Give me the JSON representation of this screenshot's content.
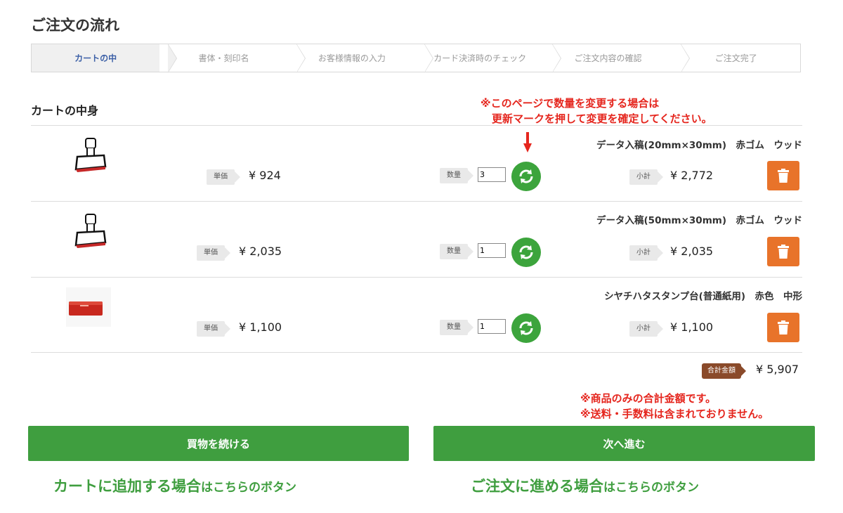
{
  "page_title": "ご注文の流れ",
  "steps": [
    {
      "label": "カートの中"
    },
    {
      "label": "書体・刻印名"
    },
    {
      "label": "お客様情報の入力"
    },
    {
      "label": "カード決済時のチェック"
    },
    {
      "label": "ご注文内容の確認"
    },
    {
      "label": "ご注文完了"
    }
  ],
  "active_step": 0,
  "cart_heading": "カートの中身",
  "notice_top": {
    "line1": "※このページで数量を変更する場合は",
    "line2": "更新マークを押して変更を確定してください。"
  },
  "labels": {
    "unit_price": "単価",
    "quantity": "数量",
    "subtotal": "小計",
    "total": "合計金額"
  },
  "items": [
    {
      "name": "データ入稿(20mm×30mm)　赤ゴム　ウッド",
      "unit_price": "¥ 924",
      "quantity": "3",
      "subtotal": "¥ 2,772",
      "image": "rubber-stamp-icon"
    },
    {
      "name": "データ入稿(50mm×30mm)　赤ゴム　ウッド",
      "unit_price": "¥ 2,035",
      "quantity": "1",
      "subtotal": "¥ 2,035",
      "image": "rubber-stamp-icon"
    },
    {
      "name": "シヤチハタスタンプ台(普通紙用)　赤色　中形",
      "unit_price": "¥ 1,100",
      "quantity": "1",
      "subtotal": "¥ 1,100",
      "image": "stamp-pad-icon"
    }
  ],
  "total_value": "¥ 5,907",
  "notice_bottom": {
    "line1": "※商品のみの合計金額です。",
    "line2": "※送料・手数料は含まれておりません。"
  },
  "buttons": {
    "continue": "買物を続ける",
    "next": "次へ進む"
  },
  "captions": {
    "left_main": "カートに追加する場合",
    "left_sub": "はこちらのボタン",
    "right_main": "ご注文に進める場合",
    "right_sub": "はこちらのボタン"
  },
  "colors": {
    "green": "#3f9e3f",
    "refresh_green": "#3ca43c",
    "orange": "#e8732a",
    "red_notice": "#e5261e",
    "total_brown": "#8a4a2a",
    "active_step_text": "#3b5fa6"
  }
}
